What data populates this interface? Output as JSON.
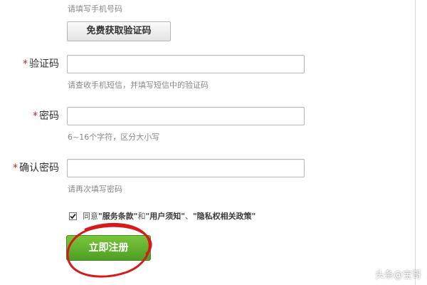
{
  "form": {
    "phone_hint": "请填写手机号码",
    "sms_button_label": "免费获取验证码",
    "required_mark": "*",
    "verification_code": {
      "label": "验证码",
      "value": "",
      "hint": "请查收手机短信，并填写短信中的验证码"
    },
    "password": {
      "label": "密码",
      "value": "",
      "hint": "6~16个字符，区分大小写"
    },
    "confirm_password": {
      "label": "确认密码",
      "value": "",
      "hint": "请再次填写密码"
    },
    "agreement": {
      "checked": true,
      "prefix": "同意",
      "terms_link": "\"服务条款\"",
      "and_text": "和",
      "notice_link": "\"用户须知\"",
      "separator": "、",
      "privacy_link": "\"隐私权相关政策\""
    },
    "register_button_label": "立即注册"
  },
  "watermark": {
    "icon": "toutiao-logo-icon",
    "text": "头条@宝哥"
  },
  "colors": {
    "required_star": "#d22222",
    "register_button": "#5aa92b",
    "annotation_circle": "#d61a1a"
  }
}
